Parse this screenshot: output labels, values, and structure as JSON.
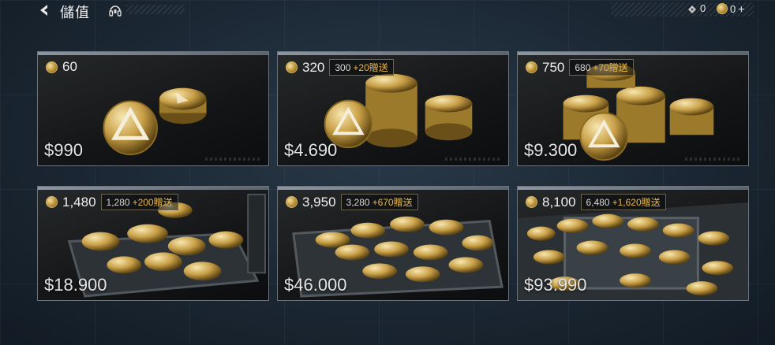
{
  "header": {
    "title": "儲值",
    "back_icon": "back-arrow-icon",
    "support_icon": "headset-icon"
  },
  "currency": {
    "tickets": "0",
    "coins": "0",
    "add_label": "+"
  },
  "packages": [
    {
      "coins": "60",
      "bonus_base": "",
      "bonus_extra": "",
      "price": "$990"
    },
    {
      "coins": "320",
      "bonus_base": "300",
      "bonus_extra": "+20贈送",
      "price": "$4.690"
    },
    {
      "coins": "750",
      "bonus_base": "680",
      "bonus_extra": "+70贈送",
      "price": "$9.300"
    },
    {
      "coins": "1,480",
      "bonus_base": "1,280",
      "bonus_extra": "+200贈送",
      "price": "$18.900"
    },
    {
      "coins": "3,950",
      "bonus_base": "3,280",
      "bonus_extra": "+670贈送",
      "price": "$46.000"
    },
    {
      "coins": "8,100",
      "bonus_base": "6,480",
      "bonus_extra": "+1,620贈送",
      "price": "$93.990"
    }
  ],
  "colors": {
    "bonus_accent": "#e8b84c",
    "coin_gold": "#c9a048"
  }
}
